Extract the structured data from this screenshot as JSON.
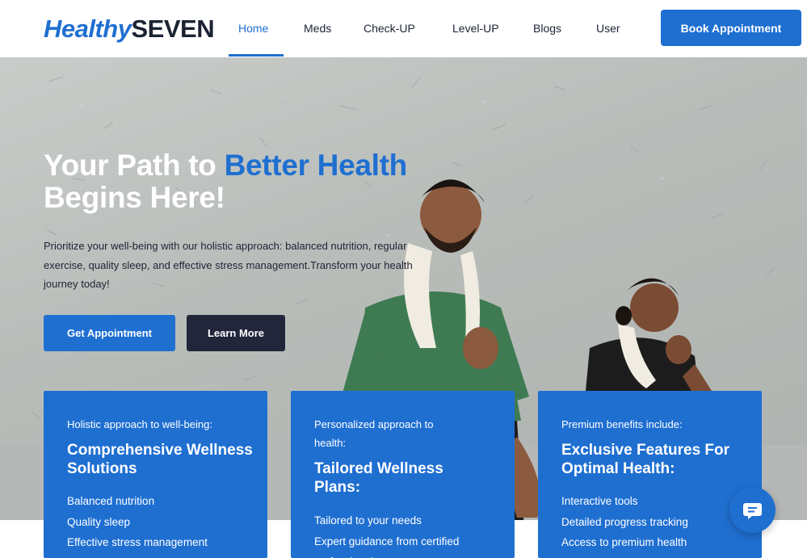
{
  "nav": {
    "logo_part1": "Healthy",
    "logo_part2": "SEVEN",
    "items": [
      {
        "label": "Home"
      },
      {
        "label": "Meds"
      },
      {
        "label": "Check-UP"
      },
      {
        "label": "Level-UP"
      },
      {
        "label": "Blogs"
      },
      {
        "label": "User"
      }
    ],
    "active_item": "Home",
    "cta_label": "Book Appointment"
  },
  "hero": {
    "headline_part1": "Your Path to ",
    "headline_highlight": "Better Health",
    "headline_part2": "Begins Here!",
    "description": "Prioritize your well-being with our holistic approach: balanced nutrition, regular exercise, quality sleep, and effective stress management.Transform your health journey today!",
    "primary_button": "Get Appointment",
    "secondary_button": "Learn More",
    "image_alt": "Man and woman doing squats"
  },
  "cards": [
    {
      "eyebrow": "Holistic approach to well-being:",
      "title": "Comprehensive Wellness Solutions",
      "items": [
        "Balanced nutrition",
        "Quality sleep",
        "Effective stress management"
      ]
    },
    {
      "eyebrow": "Personalized approach to health:",
      "title": "Tailored Wellness Plans:",
      "items": [
        "Tailored to your needs",
        "Expert guidance from certified professionals"
      ]
    },
    {
      "eyebrow": "Premium benefits include:",
      "title": "Exclusive Features For Optimal Health:",
      "items": [
        "Interactive tools",
        "Detailed progress tracking",
        "Access to premium health"
      ]
    }
  ],
  "chat_button": {
    "icon": "chat-icon"
  },
  "colors": {
    "accent": "#1f6fd1",
    "dark": "#22263a",
    "text": "#1c2333",
    "white": "#ffffff"
  }
}
